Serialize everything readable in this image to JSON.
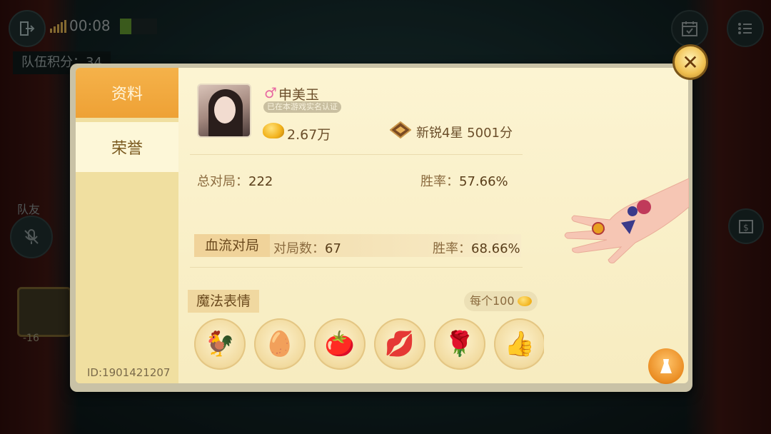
{
  "hud": {
    "clock": "00:08",
    "team_score": "队伍积分：34",
    "teammate_label": "队友",
    "teammate_score": "-16"
  },
  "dialog": {
    "tabs": [
      "资料",
      "荣誉"
    ],
    "active_tab": "资料",
    "player_id": "ID:1901421207",
    "profile": {
      "gender_symbol": "♂",
      "name": "申美玉",
      "verify_badge": "已在本游戏实名认证",
      "gold": "2.67万",
      "rank": "新锐4星 5001分"
    },
    "stats": {
      "total_games_label": "总对局：",
      "total_games_value": "222",
      "win_rate_label": "胜率：",
      "win_rate_value": "57.66%"
    },
    "mode": {
      "title": "血流对局",
      "games_label": "对局数：",
      "games_value": "67",
      "win_rate_label": "胜率：",
      "win_rate_value": "68.66%"
    },
    "magic": {
      "title": "魔法表情",
      "price": "每个100",
      "emotes": [
        {
          "name": "rooster",
          "glyph": "🐓"
        },
        {
          "name": "egg",
          "glyph": "🥚"
        },
        {
          "name": "tomato",
          "glyph": "🍅"
        },
        {
          "name": "lips",
          "glyph": "💋"
        },
        {
          "name": "rose",
          "glyph": "🌹"
        },
        {
          "name": "thumbs-up",
          "glyph": "👍"
        }
      ]
    }
  },
  "colors": {
    "tab_active": "#f0a838",
    "panel_bg": "#fcf4d2",
    "text_brown": "#6b4e2a",
    "gender_pink": "#e86aa2"
  }
}
